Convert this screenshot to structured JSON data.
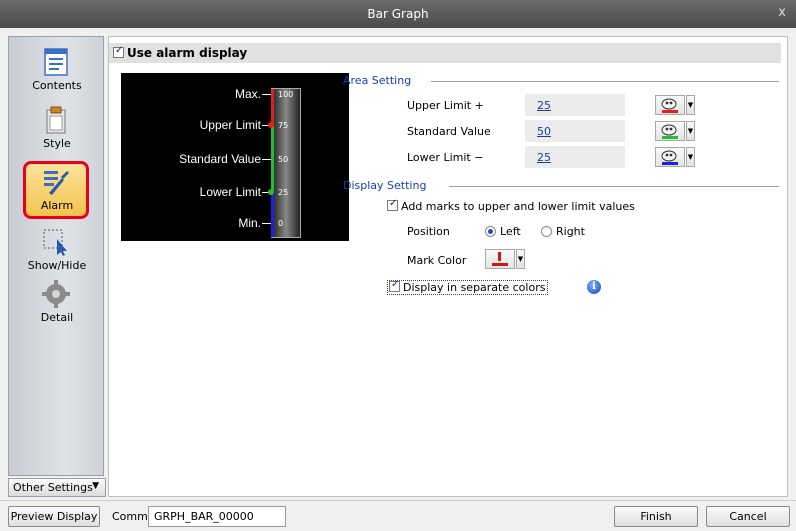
{
  "window": {
    "title": "Bar Graph",
    "close_glyph": "x"
  },
  "sidebar": {
    "items": [
      {
        "label": "Contents",
        "icon": "contents-icon"
      },
      {
        "label": "Style",
        "icon": "style-icon"
      },
      {
        "label": "Alarm",
        "icon": "alarm-icon",
        "active": true
      },
      {
        "label": "Show/Hide",
        "icon": "show-hide-icon"
      },
      {
        "label": "Detail",
        "icon": "detail-icon"
      }
    ],
    "other_settings": "Other Settings"
  },
  "main": {
    "use_alarm_display": {
      "label": "Use alarm display",
      "checked": true
    },
    "preview": {
      "labels": [
        "Max.",
        "Upper Limit",
        "Standard Value",
        "Lower Limit",
        "Min."
      ],
      "scale": [
        "100",
        "75",
        "50",
        "25",
        "0"
      ],
      "colors": {
        "upper": "#e02020",
        "middle": "#22c030",
        "lower": "#2020e0"
      }
    },
    "area_setting": {
      "title": "Area Setting",
      "rows": [
        {
          "label": "Upper Limit +",
          "value": "25"
        },
        {
          "label": "Standard Value",
          "value": "50"
        },
        {
          "label": "Lower Limit −",
          "value": "25"
        }
      ]
    },
    "display_setting": {
      "title": "Display Setting",
      "add_marks": {
        "label": "Add marks to upper and lower limit values",
        "checked": true
      },
      "position": {
        "label": "Position",
        "options": [
          "Left",
          "Right"
        ],
        "selected": "Left"
      },
      "mark_color": {
        "label": "Mark Color",
        "color": "#d01818"
      },
      "separate_colors": {
        "label": "Display in separate colors",
        "checked": true
      }
    }
  },
  "footer": {
    "preview_display": "Preview Display",
    "comm_label": "Comm",
    "comm_value": "GRPH_BAR_00000",
    "finish": "Finish",
    "cancel": "Cancel"
  }
}
